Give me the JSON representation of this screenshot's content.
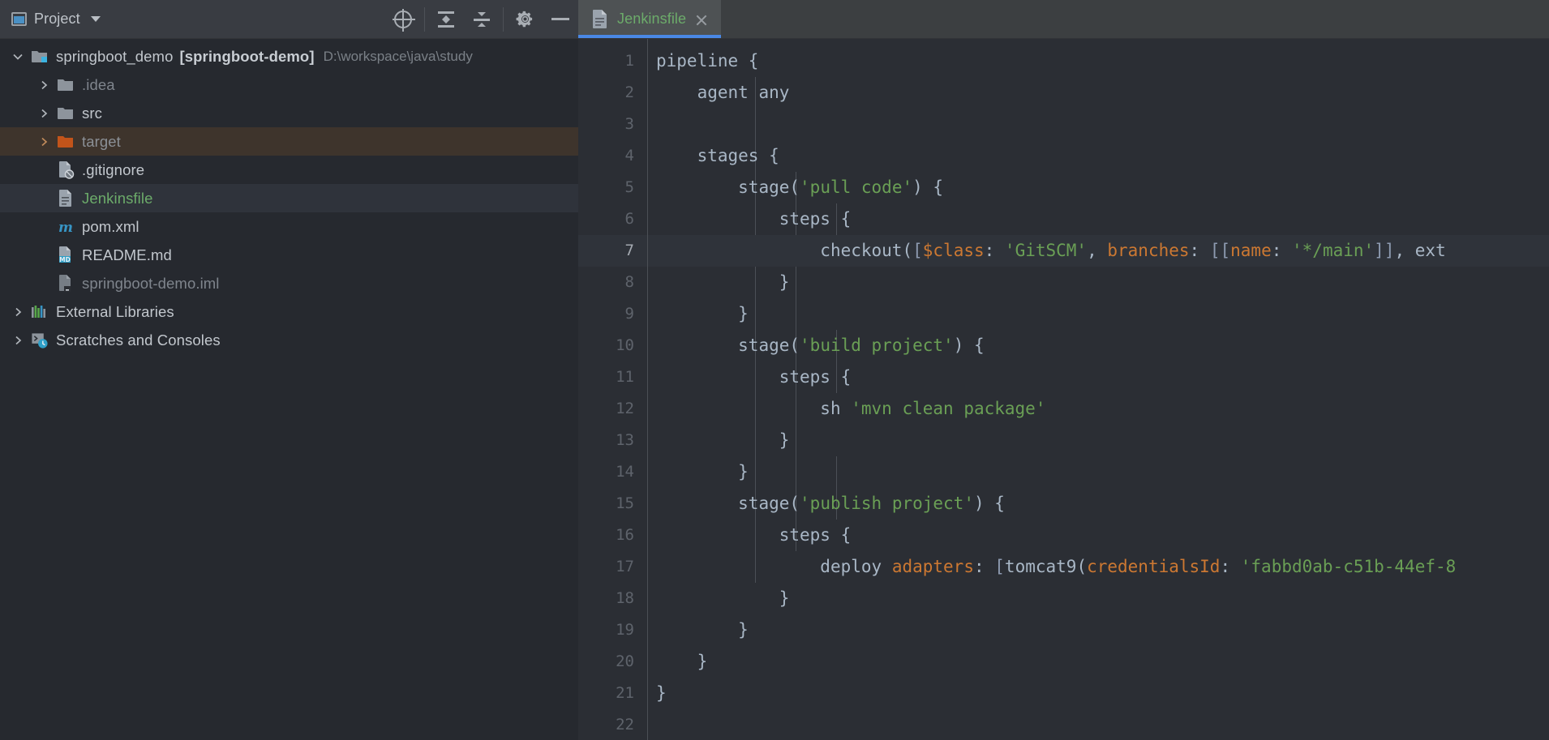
{
  "toolwindow": {
    "title": "Project",
    "dropdown_icon": "chevron-down-icon",
    "actions": [
      {
        "name": "select-opened-file",
        "icon": "locate-crosshair-icon"
      },
      {
        "name": "expand-all",
        "icon": "expand-all-icon"
      },
      {
        "name": "collapse-all",
        "icon": "collapse-all-icon"
      },
      {
        "name": "settings",
        "icon": "gear-icon"
      },
      {
        "name": "hide",
        "icon": "minus-icon"
      }
    ]
  },
  "tabs": [
    {
      "label": "Jenkinsfile",
      "icon": "file-icon",
      "active": true,
      "close_icon": "close-icon"
    }
  ],
  "tree": [
    {
      "id": "root",
      "label": "springboot_demo",
      "bold_label": "[springboot-demo]",
      "path": "D:\\workspace\\java\\study",
      "icon": "module-folder-icon",
      "twisty": "down",
      "depth": 0
    },
    {
      "id": "idea",
      "label": ".idea",
      "icon": "folder-icon",
      "twisty": "right",
      "depth": 1,
      "style": "dim"
    },
    {
      "id": "src",
      "label": "src",
      "icon": "folder-icon",
      "twisty": "right",
      "depth": 1
    },
    {
      "id": "target",
      "label": "target",
      "icon": "folder-orange-icon",
      "twisty": "right",
      "depth": 1,
      "style": "muted",
      "row": "sel-target"
    },
    {
      "id": "gitignore",
      "label": ".gitignore",
      "icon": "gitignore-file-icon",
      "twisty": "none",
      "depth": 1
    },
    {
      "id": "jenkinsfile",
      "label": "Jenkinsfile",
      "icon": "text-file-icon",
      "twisty": "none",
      "depth": 1,
      "style": "green",
      "row": "sel-file"
    },
    {
      "id": "pom",
      "label": "pom.xml",
      "icon": "maven-icon",
      "twisty": "none",
      "depth": 1
    },
    {
      "id": "readme",
      "label": "README.md",
      "icon": "markdown-file-icon",
      "twisty": "none",
      "depth": 1
    },
    {
      "id": "iml",
      "label": "springboot-demo.iml",
      "icon": "iml-file-icon",
      "twisty": "none",
      "depth": 1,
      "style": "dim"
    },
    {
      "id": "extlibs",
      "label": "External Libraries",
      "icon": "libraries-icon",
      "twisty": "right",
      "depth": 0
    },
    {
      "id": "scratches",
      "label": "Scratches and Consoles",
      "icon": "scratches-icon",
      "twisty": "right",
      "depth": 0
    }
  ],
  "editor": {
    "line_numbers": [
      1,
      2,
      3,
      4,
      5,
      6,
      7,
      8,
      9,
      10,
      11,
      12,
      13,
      14,
      15,
      16,
      17,
      18,
      19,
      20,
      21,
      22
    ],
    "current_line": 7,
    "lines": [
      "pipeline {",
      "    agent any",
      "",
      "    stages {",
      "        stage('pull code') {",
      "            steps {",
      "                checkout([$class: 'GitSCM', branches: [[name: '*/main']], ext",
      "            }",
      "        }",
      "        stage('build project') {",
      "            steps {",
      "                sh 'mvn clean package'",
      "            }",
      "        }",
      "        stage('publish project') {",
      "            steps {",
      "                deploy adapters: [tomcat9(credentialsId: 'fabbd0ab-c51b-44ef-8",
      "            }",
      "        }",
      "    }",
      "}",
      ""
    ]
  },
  "colors": {
    "accent_blue": "#4a88e5",
    "tab_text_green": "#6cab6a",
    "string_green": "#6a9f55",
    "attr_orange": "#cc7832",
    "text_default": "#a9b7c6",
    "selection_brown": "#3e342c",
    "editor_bg": "#2b2e34",
    "panel_bg": "#26292f"
  }
}
